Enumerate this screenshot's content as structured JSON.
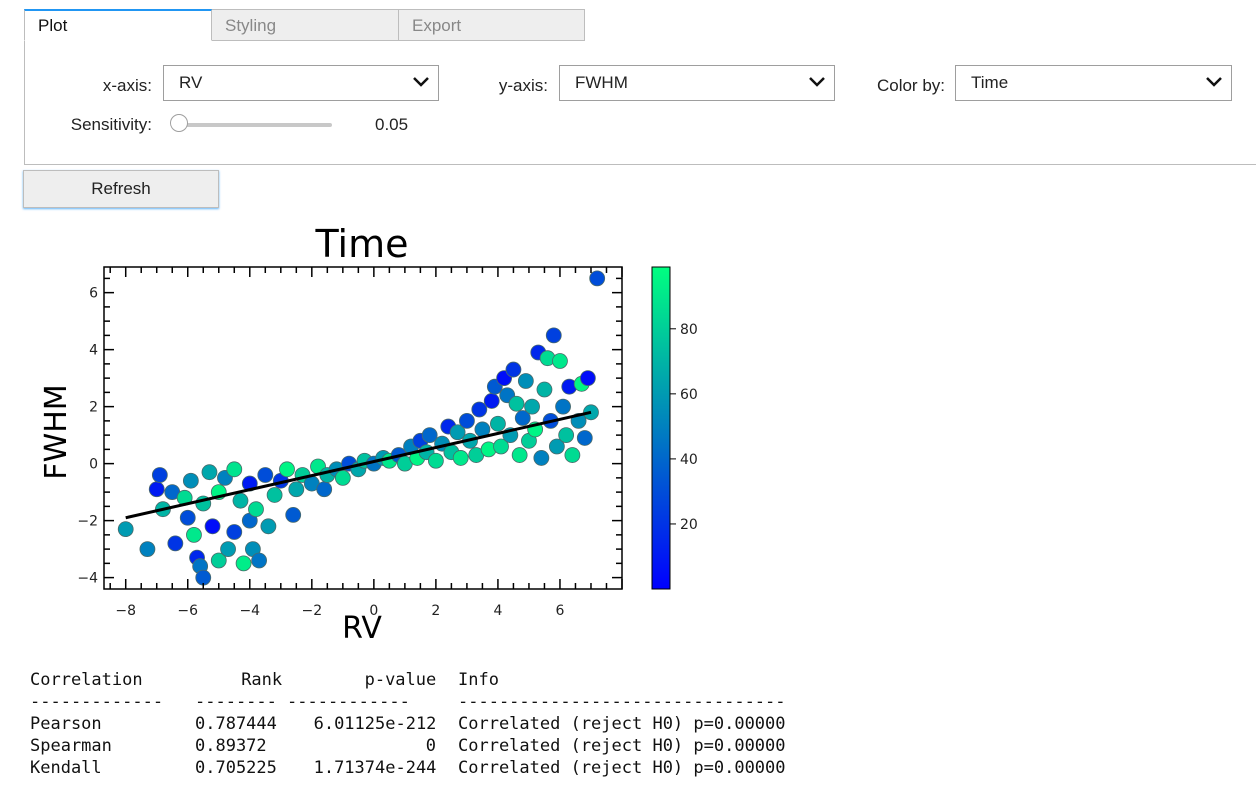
{
  "tabs": [
    {
      "label": "Plot",
      "active": true
    },
    {
      "label": "Styling",
      "active": false
    },
    {
      "label": "Export",
      "active": false
    }
  ],
  "controls": {
    "xaxis": {
      "label": "x-axis:",
      "value": "RV"
    },
    "yaxis": {
      "label": "y-axis:",
      "value": "FWHM"
    },
    "colorby": {
      "label": "Color by:",
      "value": "Time"
    },
    "sensitivity": {
      "label": "Sensitivity:",
      "value": "0.05",
      "fraction": 0.0
    },
    "refresh_label": "Refresh"
  },
  "chart_data": {
    "type": "scatter",
    "title": "Time",
    "xlabel": "RV",
    "ylabel": "FWHM",
    "xlim": [
      -8.7,
      8.0
    ],
    "ylim": [
      -4.4,
      6.9
    ],
    "xticks": [
      "−8",
      "−6",
      "−4",
      "−2",
      "0",
      "2",
      "4",
      "6"
    ],
    "yticks": [
      "−4",
      "−2",
      "0",
      "2",
      "4",
      "6"
    ],
    "colorbar": {
      "min": 0,
      "max": 99,
      "ticks": [
        "20",
        "40",
        "60",
        "80"
      ],
      "cmap": [
        "#0000ff",
        "#00ff80"
      ]
    },
    "fit_line": {
      "x": [
        -8.0,
        7.0
      ],
      "y": [
        -1.9,
        1.8
      ]
    },
    "points": [
      [
        -8.0,
        -2.3,
        60
      ],
      [
        -7.3,
        -3.0,
        50
      ],
      [
        -7.0,
        -0.9,
        10
      ],
      [
        -6.9,
        -0.4,
        25
      ],
      [
        -6.8,
        -1.6,
        70
      ],
      [
        -6.5,
        -1.0,
        40
      ],
      [
        -6.4,
        -2.8,
        20
      ],
      [
        -6.1,
        -1.2,
        85
      ],
      [
        -6.0,
        -1.9,
        30
      ],
      [
        -5.9,
        -0.6,
        55
      ],
      [
        -5.8,
        -2.5,
        90
      ],
      [
        -5.7,
        -3.3,
        15
      ],
      [
        -5.6,
        -3.6,
        45
      ],
      [
        -5.5,
        -4.0,
        35
      ],
      [
        -5.5,
        -1.4,
        75
      ],
      [
        -5.3,
        -0.3,
        65
      ],
      [
        -5.2,
        -2.2,
        5
      ],
      [
        -5.0,
        -3.4,
        80
      ],
      [
        -5.0,
        -1.0,
        95
      ],
      [
        -4.8,
        -0.5,
        50
      ],
      [
        -4.7,
        -3.0,
        60
      ],
      [
        -4.5,
        -2.4,
        25
      ],
      [
        -4.5,
        -0.2,
        88
      ],
      [
        -4.3,
        -1.3,
        70
      ],
      [
        -4.2,
        -3.5,
        92
      ],
      [
        -4.0,
        -2.0,
        40
      ],
      [
        -4.0,
        -0.7,
        10
      ],
      [
        -3.9,
        -3.0,
        55
      ],
      [
        -3.8,
        -1.6,
        85
      ],
      [
        -3.7,
        -3.4,
        45
      ],
      [
        -3.5,
        -0.4,
        30
      ],
      [
        -3.4,
        -2.2,
        60
      ],
      [
        -3.2,
        -1.1,
        75
      ],
      [
        -3.0,
        -0.6,
        20
      ],
      [
        -2.8,
        -0.2,
        95
      ],
      [
        -2.6,
        -1.8,
        35
      ],
      [
        -2.5,
        -0.9,
        65
      ],
      [
        -2.3,
        -0.4,
        80
      ],
      [
        -2.0,
        -0.7,
        50
      ],
      [
        -1.8,
        -0.1,
        90
      ],
      [
        -1.6,
        -0.9,
        40
      ],
      [
        -1.5,
        -0.4,
        70
      ],
      [
        -1.2,
        -0.2,
        55
      ],
      [
        -1.0,
        -0.5,
        85
      ],
      [
        -0.8,
        0.0,
        30
      ],
      [
        -0.5,
        -0.2,
        65
      ],
      [
        -0.3,
        0.1,
        75
      ],
      [
        0.0,
        0.0,
        45
      ],
      [
        0.3,
        0.2,
        60
      ],
      [
        0.5,
        0.1,
        90
      ],
      [
        0.8,
        0.3,
        35
      ],
      [
        1.0,
        0.0,
        80
      ],
      [
        1.2,
        0.6,
        50
      ],
      [
        1.4,
        0.2,
        95
      ],
      [
        1.5,
        0.8,
        25
      ],
      [
        1.7,
        0.4,
        70
      ],
      [
        1.8,
        1.0,
        40
      ],
      [
        2.0,
        0.1,
        85
      ],
      [
        2.2,
        0.7,
        55
      ],
      [
        2.4,
        1.3,
        15
      ],
      [
        2.5,
        0.4,
        75
      ],
      [
        2.7,
        1.1,
        60
      ],
      [
        2.8,
        0.2,
        90
      ],
      [
        3.0,
        1.5,
        30
      ],
      [
        3.1,
        0.8,
        65
      ],
      [
        3.3,
        0.3,
        80
      ],
      [
        3.4,
        1.9,
        20
      ],
      [
        3.5,
        1.2,
        50
      ],
      [
        3.7,
        0.5,
        95
      ],
      [
        3.8,
        2.2,
        10
      ],
      [
        3.9,
        2.7,
        35
      ],
      [
        4.0,
        1.4,
        70
      ],
      [
        4.1,
        0.6,
        85
      ],
      [
        4.2,
        3.0,
        5
      ],
      [
        4.3,
        2.4,
        45
      ],
      [
        4.4,
        1.0,
        60
      ],
      [
        4.5,
        3.3,
        20
      ],
      [
        4.6,
        2.1,
        75
      ],
      [
        4.7,
        0.3,
        90
      ],
      [
        4.8,
        1.6,
        40
      ],
      [
        4.9,
        2.9,
        55
      ],
      [
        5.0,
        0.8,
        80
      ],
      [
        5.1,
        2.0,
        65
      ],
      [
        5.2,
        1.2,
        95
      ],
      [
        5.3,
        3.9,
        15
      ],
      [
        5.4,
        0.2,
        50
      ],
      [
        5.5,
        2.6,
        70
      ],
      [
        5.6,
        3.7,
        85
      ],
      [
        5.7,
        1.5,
        30
      ],
      [
        5.8,
        4.5,
        25
      ],
      [
        5.9,
        0.6,
        60
      ],
      [
        6.0,
        3.6,
        90
      ],
      [
        6.1,
        2.0,
        45
      ],
      [
        6.2,
        1.0,
        75
      ],
      [
        6.3,
        2.7,
        10
      ],
      [
        6.4,
        0.3,
        85
      ],
      [
        6.6,
        1.5,
        55
      ],
      [
        6.7,
        2.8,
        95
      ],
      [
        6.8,
        0.9,
        40
      ],
      [
        6.9,
        3.0,
        5
      ],
      [
        7.0,
        1.8,
        65
      ],
      [
        7.2,
        6.5,
        30
      ]
    ]
  },
  "correlation_table": {
    "header": [
      "Correlation",
      "Rank",
      "p-value",
      "Info"
    ],
    "separator": [
      "-------------",
      "--------",
      "------------",
      "--------------------------------"
    ],
    "rows": [
      [
        "Pearson",
        "0.787444",
        "6.01125e-212",
        "Correlated (reject H0) p=0.00000"
      ],
      [
        "Spearman",
        "0.89372",
        "0",
        "Correlated (reject H0) p=0.00000"
      ],
      [
        "Kendall",
        "0.705225",
        "1.71374e-244",
        "Correlated (reject H0) p=0.00000"
      ]
    ]
  }
}
